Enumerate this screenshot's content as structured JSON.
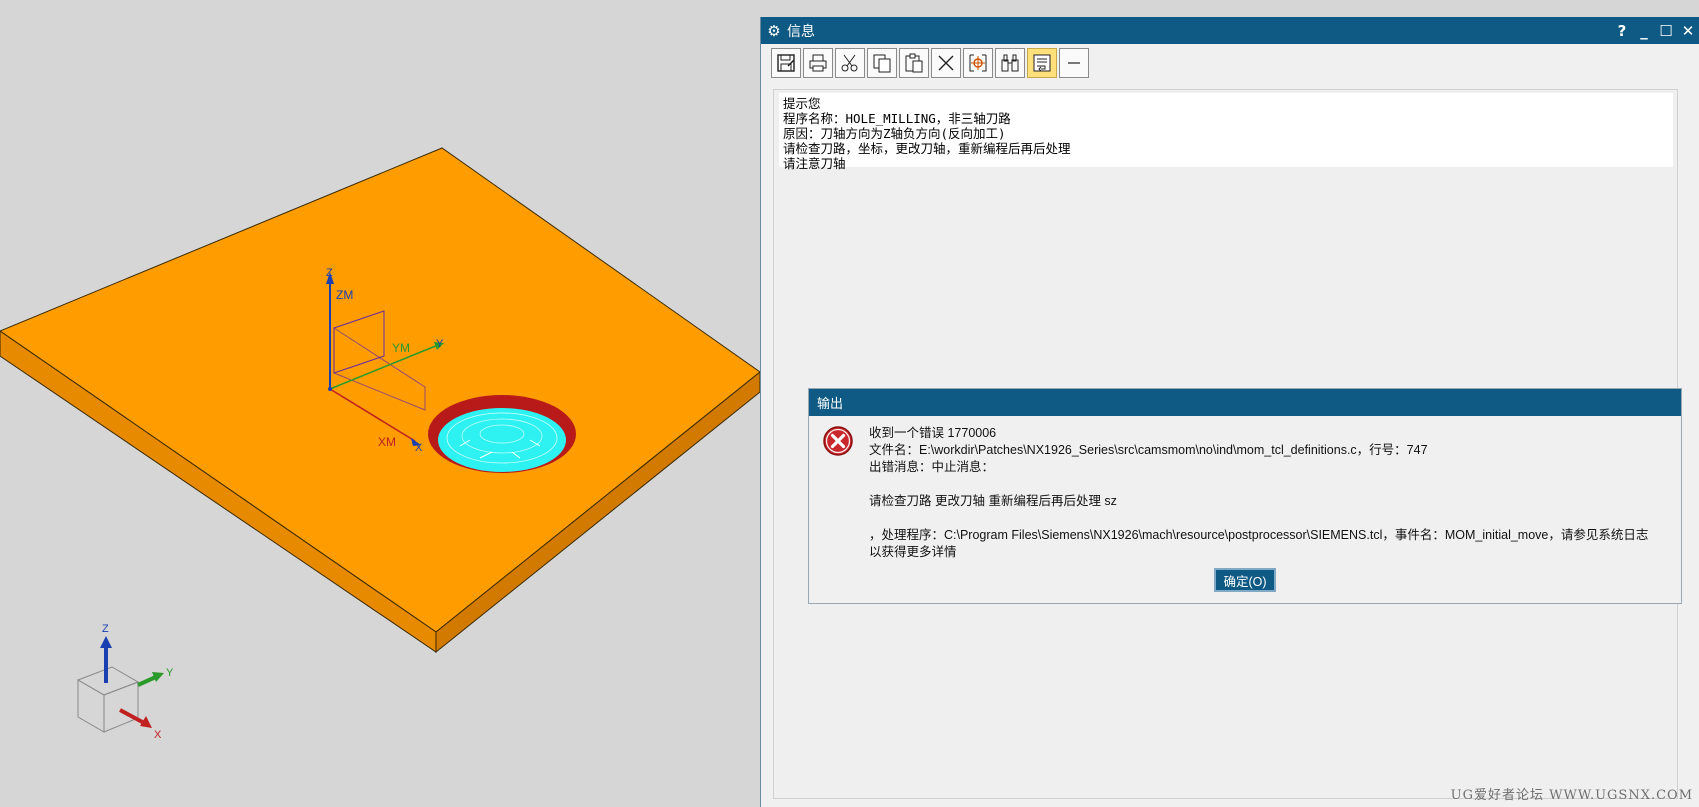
{
  "viewport": {
    "part_color": "#ff9c00",
    "hole_tool_color": "#2ef2f2",
    "csys_labels": {
      "zm": "ZM",
      "ym": "YM",
      "xm": "XM",
      "z": "Z",
      "y": "Y",
      "x": "X"
    },
    "triad_labels": {
      "z": "Z",
      "y": "Y",
      "x": "X"
    }
  },
  "info_window": {
    "title": "信息",
    "controls": {
      "help": "?",
      "minimize": "_",
      "maximize": "☐",
      "close": "✕"
    },
    "toolbar": [
      {
        "name": "save-icon",
        "active": false
      },
      {
        "name": "print-icon",
        "active": false
      },
      {
        "name": "cut-icon",
        "active": false
      },
      {
        "name": "copy-icon",
        "active": false
      },
      {
        "name": "paste-icon",
        "active": false
      },
      {
        "name": "delete-icon",
        "active": false
      },
      {
        "name": "center-icon",
        "active": false
      },
      {
        "name": "find-icon",
        "active": false
      },
      {
        "name": "wrap-icon",
        "active": true
      },
      {
        "name": "line-icon",
        "active": false
      }
    ],
    "text_lines": [
      "提示您",
      "程序名称：HOLE_MILLING，非三轴刀路",
      "原因：刀轴方向为Z轴负方向(反向加工)",
      "请检查刀路，坐标，更改刀轴，重新编程后再后处理",
      "请注意刀轴"
    ]
  },
  "output_dialog": {
    "title": "输出",
    "lines": [
      "收到一个错误 1770006",
      "文件名：E:\\workdir\\Patches\\NX1926_Series\\src\\camsmom\\no\\ind\\mom_tcl_definitions.c，行号：747",
      "出错消息：中止消息：",
      "",
      " 请检查刀路 更改刀轴 重新编程后再后处理 sz",
      "",
      "，处理程序：C:\\Program Files\\Siemens\\NX1926\\mach\\resource\\postprocessor\\SIEMENS.tcl，事件名：MOM_initial_move，请参见系统日志",
      "以获得更多详情"
    ],
    "ok_label": "确定(O)"
  },
  "watermark": "UG爱好者论坛 WWW.UGSNX.COM"
}
